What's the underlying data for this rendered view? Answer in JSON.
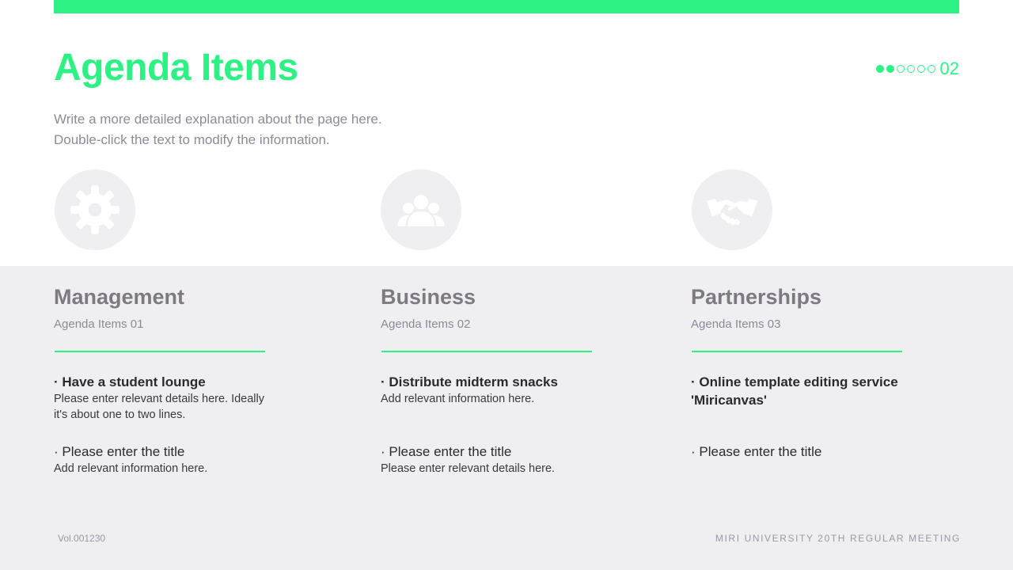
{
  "header": {
    "title": "Agenda Items",
    "page_number": "02",
    "pager_dots": {
      "filled": 2,
      "hollow": 4
    },
    "description_lines": [
      "Write a more detailed explanation about the page here.",
      "Double-click the text to modify the information."
    ]
  },
  "columns": [
    {
      "icon": "gear-icon",
      "title": "Management",
      "subtitle": "Agenda Items 01",
      "items": [
        {
          "title": "· Have a student lounge",
          "desc": "Please enter relevant details here. Ideally it's about one to two lines."
        },
        {
          "title": "· Please enter the title",
          "desc": "Add relevant information here."
        }
      ]
    },
    {
      "icon": "people-icon",
      "title": "Business",
      "subtitle": "Agenda Items 02",
      "items": [
        {
          "title": "· Distribute midterm snacks",
          "desc": "Add relevant information here."
        },
        {
          "title": "· Please enter the title",
          "desc": "Please enter relevant details here."
        }
      ]
    },
    {
      "icon": "handshake-icon",
      "title": "Partnerships",
      "subtitle": "Agenda Items 03",
      "items": [
        {
          "title": "· Online template editing service 'Miricanvas'",
          "desc": ""
        },
        {
          "title": "· Please enter the title",
          "desc": ""
        }
      ]
    }
  ],
  "footer": {
    "volume": "Vol.001230",
    "event": "MIRI UNIVERSITY 20TH REGULAR MEETING"
  },
  "colors": {
    "accent": "#2cf284",
    "panel_bg": "#efeef1",
    "icon_fg": "#ffffff"
  }
}
